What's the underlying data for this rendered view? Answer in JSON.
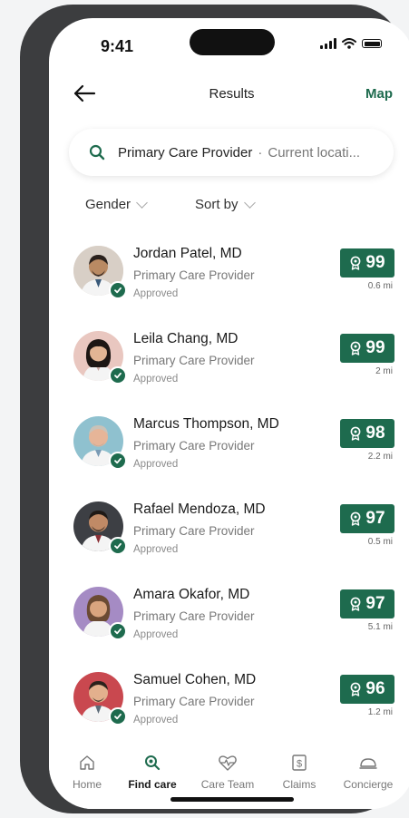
{
  "status_bar": {
    "time": "9:41"
  },
  "navbar": {
    "title": "Results",
    "map_label": "Map"
  },
  "search": {
    "query": "Primary Care Provider",
    "separator": "·",
    "location": "Current locati..."
  },
  "filters": {
    "gender_label": "Gender",
    "sort_label": "Sort by"
  },
  "colors": {
    "brand": "#1e6b4e",
    "text": "#222222",
    "muted": "#777777"
  },
  "providers": [
    {
      "name": "Jordan Patel, MD",
      "specialty": "Primary Care Provider",
      "status": "Approved",
      "score": "99",
      "distance": "0.6 mi"
    },
    {
      "name": "Leila Chang, MD",
      "specialty": "Primary Care Provider",
      "status": "Approved",
      "score": "99",
      "distance": "2 mi"
    },
    {
      "name": "Marcus Thompson, MD",
      "specialty": "Primary Care Provider",
      "status": "Approved",
      "score": "98",
      "distance": "2.2 mi"
    },
    {
      "name": "Rafael Mendoza, MD",
      "specialty": "Primary Care Provider",
      "status": "Approved",
      "score": "97",
      "distance": "0.5 mi"
    },
    {
      "name": "Amara Okafor, MD",
      "specialty": "Primary Care Provider",
      "status": "Approved",
      "score": "97",
      "distance": "5.1 mi"
    },
    {
      "name": "Samuel Cohen, MD",
      "specialty": "Primary Care Provider",
      "status": "Approved",
      "score": "96",
      "distance": "1.2 mi"
    }
  ],
  "tabs": [
    {
      "label": "Home",
      "icon": "home-icon"
    },
    {
      "label": "Find care",
      "icon": "find-care-icon",
      "active": true
    },
    {
      "label": "Care Team",
      "icon": "heart-pulse-icon"
    },
    {
      "label": "Claims",
      "icon": "dollar-icon"
    },
    {
      "label": "Concierge",
      "icon": "service-bell-icon"
    }
  ]
}
